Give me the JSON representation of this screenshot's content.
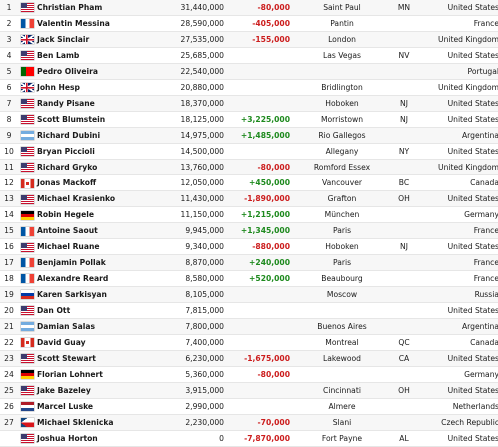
{
  "leaderboard": {
    "rows": [
      {
        "rank": "1",
        "flag": "us",
        "flag_icon": "us-flag-icon",
        "name": "Christian Pham",
        "chips": "31,440,000",
        "change": "-80,000",
        "change_type": "neg",
        "city": "Saint Paul",
        "state": "MN",
        "country": "United States"
      },
      {
        "rank": "2",
        "flag": "fr",
        "flag_icon": "france-flag-icon",
        "name": "Valentin Messina",
        "chips": "28,590,000",
        "change": "-405,000",
        "change_type": "neg",
        "city": "Pantin",
        "state": "",
        "country": "France"
      },
      {
        "rank": "3",
        "flag": "gb",
        "flag_icon": "uk-flag-icon",
        "name": "Jack Sinclair",
        "chips": "27,535,000",
        "change": "-155,000",
        "change_type": "neg",
        "city": "London",
        "state": "",
        "country": "United Kingdom"
      },
      {
        "rank": "4",
        "flag": "us",
        "flag_icon": "us-flag-icon",
        "name": "Ben Lamb",
        "chips": "25,685,000",
        "change": "",
        "change_type": "",
        "city": "Las Vegas",
        "state": "NV",
        "country": "United States"
      },
      {
        "rank": "5",
        "flag": "pt",
        "flag_icon": "portugal-flag-icon",
        "name": "Pedro Oliveira",
        "chips": "22,540,000",
        "change": "",
        "change_type": "",
        "city": "",
        "state": "",
        "country": "Portugal"
      },
      {
        "rank": "6",
        "flag": "gb",
        "flag_icon": "uk-flag-icon",
        "name": "John Hesp",
        "chips": "20,880,000",
        "change": "",
        "change_type": "",
        "city": "Bridlington",
        "state": "",
        "country": "United Kingdom"
      },
      {
        "rank": "7",
        "flag": "us",
        "flag_icon": "us-flag-icon",
        "name": "Randy Pisane",
        "chips": "18,370,000",
        "change": "",
        "change_type": "",
        "city": "Hoboken",
        "state": "NJ",
        "country": "United States"
      },
      {
        "rank": "8",
        "flag": "us",
        "flag_icon": "us-flag-icon",
        "name": "Scott Blumstein",
        "chips": "18,125,000",
        "change": "+3,225,000",
        "change_type": "pos",
        "city": "Morristown",
        "state": "NJ",
        "country": "United States"
      },
      {
        "rank": "9",
        "flag": "ar",
        "flag_icon": "argentina-flag-icon",
        "name": "Richard Dubini",
        "chips": "14,975,000",
        "change": "+1,485,000",
        "change_type": "pos",
        "city": "Rio Gallegos",
        "state": "",
        "country": "Argentina"
      },
      {
        "rank": "10",
        "flag": "us",
        "flag_icon": "us-flag-icon",
        "name": "Bryan Piccioli",
        "chips": "14,500,000",
        "change": "",
        "change_type": "",
        "city": "Allegany",
        "state": "NY",
        "country": "United States"
      },
      {
        "rank": "11",
        "flag": "us",
        "flag_icon": "us-flag-icon",
        "name": "Richard Gryko",
        "chips": "13,760,000",
        "change": "-80,000",
        "change_type": "neg",
        "city": "Romford Essex",
        "state": "",
        "country": "United Kingdom"
      },
      {
        "rank": "12",
        "flag": "ca",
        "flag_icon": "canada-flag-icon",
        "name": "Jonas Mackoff",
        "chips": "12,050,000",
        "change": "+450,000",
        "change_type": "pos",
        "city": "Vancouver",
        "state": "BC",
        "country": "Canada"
      },
      {
        "rank": "13",
        "flag": "us",
        "flag_icon": "us-flag-icon",
        "name": "Michael Krasienko",
        "chips": "11,430,000",
        "change": "-1,890,000",
        "change_type": "neg",
        "city": "Grafton",
        "state": "OH",
        "country": "United States"
      },
      {
        "rank": "14",
        "flag": "de",
        "flag_icon": "germany-flag-icon",
        "name": "Robin Hegele",
        "chips": "11,150,000",
        "change": "+1,215,000",
        "change_type": "pos",
        "city": "München",
        "state": "",
        "country": "Germany"
      },
      {
        "rank": "15",
        "flag": "fr",
        "flag_icon": "france-flag-icon",
        "name": "Antoine Saout",
        "chips": "9,945,000",
        "change": "+1,345,000",
        "change_type": "pos",
        "city": "Paris",
        "state": "",
        "country": "France"
      },
      {
        "rank": "16",
        "flag": "us",
        "flag_icon": "us-flag-icon",
        "name": "Michael Ruane",
        "chips": "9,340,000",
        "change": "-880,000",
        "change_type": "neg",
        "city": "Hoboken",
        "state": "NJ",
        "country": "United States"
      },
      {
        "rank": "17",
        "flag": "fr",
        "flag_icon": "france-flag-icon",
        "name": "Benjamin Pollak",
        "chips": "8,870,000",
        "change": "+240,000",
        "change_type": "pos",
        "city": "Paris",
        "state": "",
        "country": "France"
      },
      {
        "rank": "18",
        "flag": "fr",
        "flag_icon": "france-flag-icon",
        "name": "Alexandre Reard",
        "chips": "8,580,000",
        "change": "+520,000",
        "change_type": "pos",
        "city": "Beaubourg",
        "state": "",
        "country": "France"
      },
      {
        "rank": "19",
        "flag": "ru",
        "flag_icon": "russia-flag-icon",
        "name": "Karen Sarkisyan",
        "chips": "8,105,000",
        "change": "",
        "change_type": "",
        "city": "Moscow",
        "state": "",
        "country": "Russia"
      },
      {
        "rank": "20",
        "flag": "us",
        "flag_icon": "us-flag-icon",
        "name": "Dan Ott",
        "chips": "7,815,000",
        "change": "",
        "change_type": "",
        "city": "",
        "state": "",
        "country": "United States"
      },
      {
        "rank": "21",
        "flag": "ar",
        "flag_icon": "argentina-flag-icon",
        "name": "Damian Salas",
        "chips": "7,800,000",
        "change": "",
        "change_type": "",
        "city": "Buenos Aires",
        "state": "",
        "country": "Argentina"
      },
      {
        "rank": "22",
        "flag": "ca",
        "flag_icon": "canada-flag-icon",
        "name": "David Guay",
        "chips": "7,400,000",
        "change": "",
        "change_type": "",
        "city": "Montreal",
        "state": "QC",
        "country": "Canada"
      },
      {
        "rank": "23",
        "flag": "us",
        "flag_icon": "us-flag-icon",
        "name": "Scott Stewart",
        "chips": "6,230,000",
        "change": "-1,675,000",
        "change_type": "neg",
        "city": "Lakewood",
        "state": "CA",
        "country": "United States"
      },
      {
        "rank": "24",
        "flag": "de",
        "flag_icon": "germany-flag-icon",
        "name": "Florian Lohnert",
        "chips": "5,360,000",
        "change": "-80,000",
        "change_type": "neg",
        "city": "",
        "state": "",
        "country": "Germany"
      },
      {
        "rank": "25",
        "flag": "us",
        "flag_icon": "us-flag-icon",
        "name": "Jake Bazeley",
        "chips": "3,915,000",
        "change": "",
        "change_type": "",
        "city": "Cincinnati",
        "state": "OH",
        "country": "United States"
      },
      {
        "rank": "26",
        "flag": "nl",
        "flag_icon": "netherlands-flag-icon",
        "name": "Marcel Luske",
        "chips": "2,990,000",
        "change": "",
        "change_type": "",
        "city": "Almere",
        "state": "",
        "country": "Netherlands"
      },
      {
        "rank": "27",
        "flag": "cz",
        "flag_icon": "czech-flag-icon",
        "name": "Michael Sklenicka",
        "chips": "2,230,000",
        "change": "-70,000",
        "change_type": "neg",
        "city": "Slani",
        "state": "",
        "country": "Czech Republic"
      },
      {
        "rank": "",
        "flag": "us",
        "flag_icon": "us-flag-icon",
        "name": "Joshua Horton",
        "chips": "0",
        "change": "-7,870,000",
        "change_type": "neg",
        "city": "Fort Payne",
        "state": "AL",
        "country": "United States"
      }
    ]
  },
  "colors": {
    "positive_change": "#1e8a1e",
    "negative_change": "#cc1d1d",
    "row_alt_bg": "#f7f7f7",
    "row_bg": "#ffffff"
  }
}
